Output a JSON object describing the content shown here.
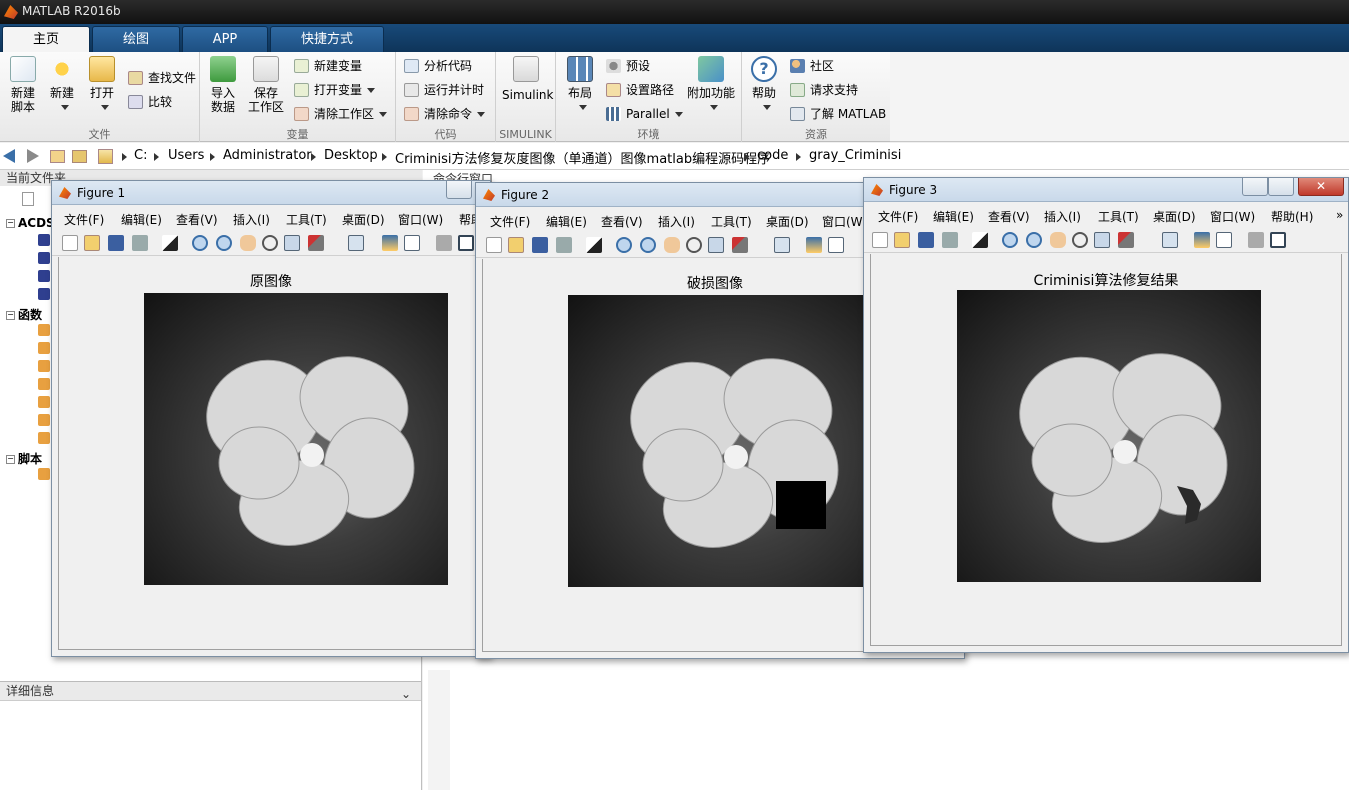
{
  "app": {
    "title": "MATLAB R2016b"
  },
  "tabs": [
    "主页",
    "绘图",
    "APP",
    "快捷方式"
  ],
  "ribbon": {
    "file": {
      "label": "文件",
      "new_script": [
        "新建",
        "脚本"
      ],
      "new": "新建",
      "open": "打开",
      "find_files": "查找文件",
      "compare": "比较"
    },
    "variable": {
      "label": "变量",
      "import": [
        "导入",
        "数据"
      ],
      "save_ws": [
        "保存",
        "工作区"
      ],
      "new_var": "新建变量",
      "open_var": "打开变量",
      "clear_ws": "清除工作区"
    },
    "code": {
      "label": "代码",
      "analyze": "分析代码",
      "run_time": "运行并计时",
      "clear_cmd": "清除命令"
    },
    "simulink": {
      "label": "SIMULINK",
      "btn": "Simulink"
    },
    "env": {
      "label": "环境",
      "layout": "布局",
      "prefs": "预设",
      "set_path": "设置路径",
      "parallel": "Parallel",
      "addons": "附加功能"
    },
    "resources": {
      "label": "资源",
      "help": "帮助",
      "community": "社区",
      "support": "请求支持",
      "learn": "了解 MATLAB"
    }
  },
  "path": [
    "C:",
    "Users",
    "Administrator",
    "Desktop",
    "Criminisi方法修复灰度图像（单通道）图像matlab编程源码程序",
    "code",
    "gray_Criminisi"
  ],
  "left_panel": {
    "header": "当前文件夹",
    "tree": [
      {
        "label": "ACDS"
      },
      {
        "label": "函数"
      },
      {
        "label": "脚本"
      }
    ],
    "details": "详细信息"
  },
  "command_window": {
    "header": "命令行窗口"
  },
  "figures": [
    {
      "title": "Figure 1",
      "axes_title": "原图像",
      "menus": [
        "文件(F)",
        "编辑(E)",
        "查看(V)",
        "插入(I)",
        "工具(T)",
        "桌面(D)",
        "窗口(W)",
        "帮助"
      ]
    },
    {
      "title": "Figure 2",
      "axes_title": "破损图像",
      "menus": [
        "文件(F)",
        "编辑(E)",
        "查看(V)",
        "插入(I)",
        "工具(T)",
        "桌面(D)",
        "窗口(W"
      ]
    },
    {
      "title": "Figure 3",
      "axes_title": "Criminisi算法修复结果",
      "menus": [
        "文件(F)",
        "编辑(E)",
        "查看(V)",
        "插入(I)",
        "工具(T)",
        "桌面(D)",
        "窗口(W)",
        "帮助(H)"
      ]
    }
  ]
}
